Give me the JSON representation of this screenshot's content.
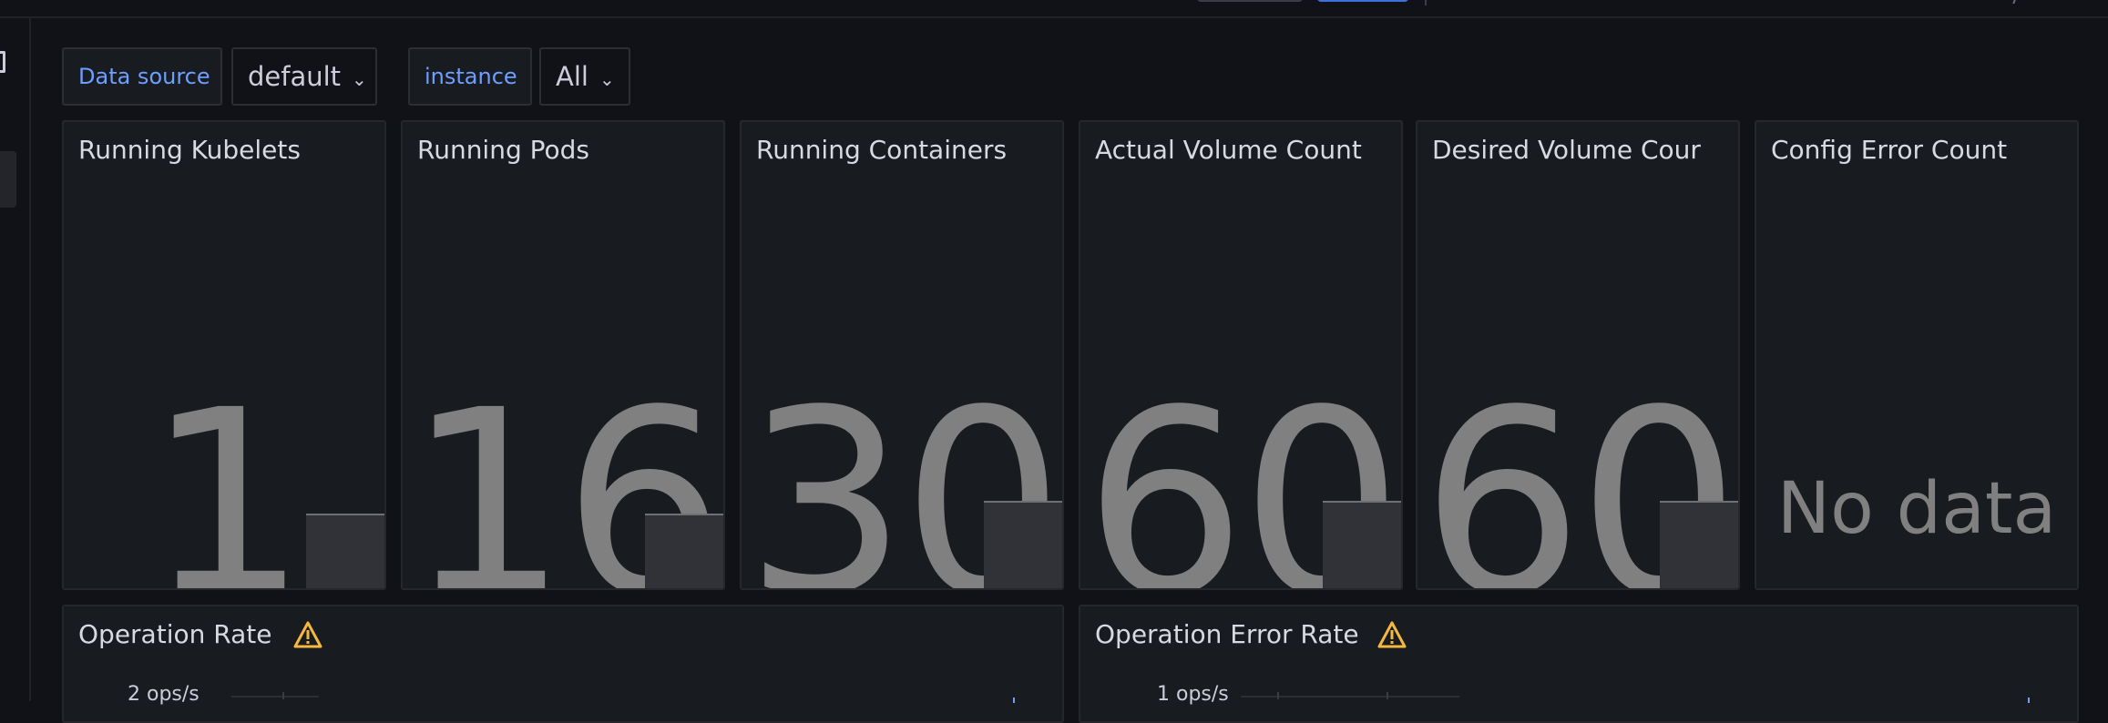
{
  "variables": [
    {
      "label": "Data source",
      "value": "default"
    },
    {
      "label": "instance",
      "value": "All"
    }
  ],
  "stat_panels": [
    {
      "title": "Running Kubelets",
      "value": "1"
    },
    {
      "title": "Running Pods",
      "value": "16"
    },
    {
      "title": "Running Containers",
      "value": "30"
    },
    {
      "title": "Actual Volume Count",
      "value": "60"
    },
    {
      "title": "Desired Volume Cour",
      "value": "60"
    },
    {
      "title": "Config Error Count",
      "value": "No data"
    }
  ],
  "graph_panels": [
    {
      "title": "Operation Rate",
      "y_tick_top": "2 ops/s",
      "warning_icon": "warning-icon"
    },
    {
      "title": "Operation Error Rate",
      "y_tick_top": "1 ops/s",
      "warning_icon": "warning-icon"
    }
  ],
  "colors": {
    "background": "#111217",
    "panel": "#181b1f",
    "accent_blue": "#6e9fff",
    "primary_button": "#3d71d9",
    "stat_value": "#808080",
    "warning": "#f5b73d"
  }
}
